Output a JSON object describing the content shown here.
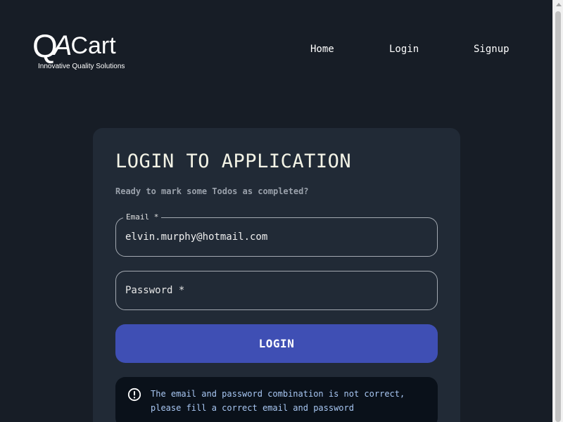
{
  "header": {
    "logo": {
      "mark": "QA",
      "brand": "Cart",
      "tagline": "Innovative Quality Solutions"
    },
    "nav": [
      {
        "label": "Home"
      },
      {
        "label": "Login"
      },
      {
        "label": "Signup"
      }
    ]
  },
  "login_card": {
    "title": "LOGIN TO APPLICATION",
    "subtitle": "Ready to mark some Todos as completed?",
    "email": {
      "label": "Email *",
      "value": "elvin.murphy@hotmail.com"
    },
    "password": {
      "placeholder": "Password *",
      "value": ""
    },
    "submit_label": "LOGIN",
    "error": {
      "icon": "info-circle-icon",
      "message_line1": "The email and password combination is not correct,",
      "message_line2": "please fill a correct email and password"
    }
  },
  "colors": {
    "background": "#171d26",
    "card": "#212a36",
    "primary_button": "#3f4fb4",
    "alert_background": "#0a111a",
    "alert_text": "#a8c7f3"
  }
}
